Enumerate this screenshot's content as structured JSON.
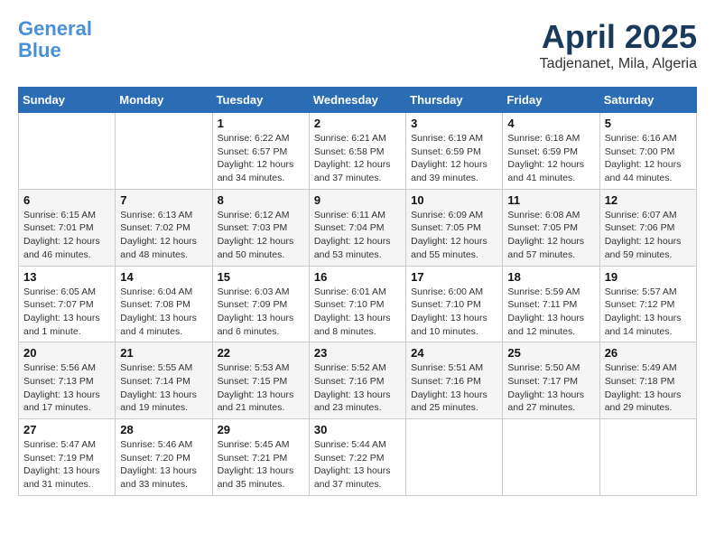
{
  "logo": {
    "line1": "General",
    "line2": "Blue"
  },
  "header": {
    "month": "April 2025",
    "location": "Tadjenanet, Mila, Algeria"
  },
  "weekdays": [
    "Sunday",
    "Monday",
    "Tuesday",
    "Wednesday",
    "Thursday",
    "Friday",
    "Saturday"
  ],
  "weeks": [
    [
      {
        "day": "",
        "sunrise": "",
        "sunset": "",
        "daylight": ""
      },
      {
        "day": "",
        "sunrise": "",
        "sunset": "",
        "daylight": ""
      },
      {
        "day": "1",
        "sunrise": "Sunrise: 6:22 AM",
        "sunset": "Sunset: 6:57 PM",
        "daylight": "Daylight: 12 hours and 34 minutes."
      },
      {
        "day": "2",
        "sunrise": "Sunrise: 6:21 AM",
        "sunset": "Sunset: 6:58 PM",
        "daylight": "Daylight: 12 hours and 37 minutes."
      },
      {
        "day": "3",
        "sunrise": "Sunrise: 6:19 AM",
        "sunset": "Sunset: 6:59 PM",
        "daylight": "Daylight: 12 hours and 39 minutes."
      },
      {
        "day": "4",
        "sunrise": "Sunrise: 6:18 AM",
        "sunset": "Sunset: 6:59 PM",
        "daylight": "Daylight: 12 hours and 41 minutes."
      },
      {
        "day": "5",
        "sunrise": "Sunrise: 6:16 AM",
        "sunset": "Sunset: 7:00 PM",
        "daylight": "Daylight: 12 hours and 44 minutes."
      }
    ],
    [
      {
        "day": "6",
        "sunrise": "Sunrise: 6:15 AM",
        "sunset": "Sunset: 7:01 PM",
        "daylight": "Daylight: 12 hours and 46 minutes."
      },
      {
        "day": "7",
        "sunrise": "Sunrise: 6:13 AM",
        "sunset": "Sunset: 7:02 PM",
        "daylight": "Daylight: 12 hours and 48 minutes."
      },
      {
        "day": "8",
        "sunrise": "Sunrise: 6:12 AM",
        "sunset": "Sunset: 7:03 PM",
        "daylight": "Daylight: 12 hours and 50 minutes."
      },
      {
        "day": "9",
        "sunrise": "Sunrise: 6:11 AM",
        "sunset": "Sunset: 7:04 PM",
        "daylight": "Daylight: 12 hours and 53 minutes."
      },
      {
        "day": "10",
        "sunrise": "Sunrise: 6:09 AM",
        "sunset": "Sunset: 7:05 PM",
        "daylight": "Daylight: 12 hours and 55 minutes."
      },
      {
        "day": "11",
        "sunrise": "Sunrise: 6:08 AM",
        "sunset": "Sunset: 7:05 PM",
        "daylight": "Daylight: 12 hours and 57 minutes."
      },
      {
        "day": "12",
        "sunrise": "Sunrise: 6:07 AM",
        "sunset": "Sunset: 7:06 PM",
        "daylight": "Daylight: 12 hours and 59 minutes."
      }
    ],
    [
      {
        "day": "13",
        "sunrise": "Sunrise: 6:05 AM",
        "sunset": "Sunset: 7:07 PM",
        "daylight": "Daylight: 13 hours and 1 minute."
      },
      {
        "day": "14",
        "sunrise": "Sunrise: 6:04 AM",
        "sunset": "Sunset: 7:08 PM",
        "daylight": "Daylight: 13 hours and 4 minutes."
      },
      {
        "day": "15",
        "sunrise": "Sunrise: 6:03 AM",
        "sunset": "Sunset: 7:09 PM",
        "daylight": "Daylight: 13 hours and 6 minutes."
      },
      {
        "day": "16",
        "sunrise": "Sunrise: 6:01 AM",
        "sunset": "Sunset: 7:10 PM",
        "daylight": "Daylight: 13 hours and 8 minutes."
      },
      {
        "day": "17",
        "sunrise": "Sunrise: 6:00 AM",
        "sunset": "Sunset: 7:10 PM",
        "daylight": "Daylight: 13 hours and 10 minutes."
      },
      {
        "day": "18",
        "sunrise": "Sunrise: 5:59 AM",
        "sunset": "Sunset: 7:11 PM",
        "daylight": "Daylight: 13 hours and 12 minutes."
      },
      {
        "day": "19",
        "sunrise": "Sunrise: 5:57 AM",
        "sunset": "Sunset: 7:12 PM",
        "daylight": "Daylight: 13 hours and 14 minutes."
      }
    ],
    [
      {
        "day": "20",
        "sunrise": "Sunrise: 5:56 AM",
        "sunset": "Sunset: 7:13 PM",
        "daylight": "Daylight: 13 hours and 17 minutes."
      },
      {
        "day": "21",
        "sunrise": "Sunrise: 5:55 AM",
        "sunset": "Sunset: 7:14 PM",
        "daylight": "Daylight: 13 hours and 19 minutes."
      },
      {
        "day": "22",
        "sunrise": "Sunrise: 5:53 AM",
        "sunset": "Sunset: 7:15 PM",
        "daylight": "Daylight: 13 hours and 21 minutes."
      },
      {
        "day": "23",
        "sunrise": "Sunrise: 5:52 AM",
        "sunset": "Sunset: 7:16 PM",
        "daylight": "Daylight: 13 hours and 23 minutes."
      },
      {
        "day": "24",
        "sunrise": "Sunrise: 5:51 AM",
        "sunset": "Sunset: 7:16 PM",
        "daylight": "Daylight: 13 hours and 25 minutes."
      },
      {
        "day": "25",
        "sunrise": "Sunrise: 5:50 AM",
        "sunset": "Sunset: 7:17 PM",
        "daylight": "Daylight: 13 hours and 27 minutes."
      },
      {
        "day": "26",
        "sunrise": "Sunrise: 5:49 AM",
        "sunset": "Sunset: 7:18 PM",
        "daylight": "Daylight: 13 hours and 29 minutes."
      }
    ],
    [
      {
        "day": "27",
        "sunrise": "Sunrise: 5:47 AM",
        "sunset": "Sunset: 7:19 PM",
        "daylight": "Daylight: 13 hours and 31 minutes."
      },
      {
        "day": "28",
        "sunrise": "Sunrise: 5:46 AM",
        "sunset": "Sunset: 7:20 PM",
        "daylight": "Daylight: 13 hours and 33 minutes."
      },
      {
        "day": "29",
        "sunrise": "Sunrise: 5:45 AM",
        "sunset": "Sunset: 7:21 PM",
        "daylight": "Daylight: 13 hours and 35 minutes."
      },
      {
        "day": "30",
        "sunrise": "Sunrise: 5:44 AM",
        "sunset": "Sunset: 7:22 PM",
        "daylight": "Daylight: 13 hours and 37 minutes."
      },
      {
        "day": "",
        "sunrise": "",
        "sunset": "",
        "daylight": ""
      },
      {
        "day": "",
        "sunrise": "",
        "sunset": "",
        "daylight": ""
      },
      {
        "day": "",
        "sunrise": "",
        "sunset": "",
        "daylight": ""
      }
    ]
  ]
}
